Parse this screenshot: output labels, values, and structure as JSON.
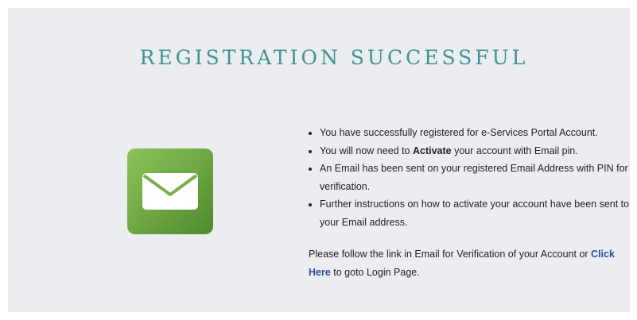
{
  "page": {
    "title": "REGISTRATION SUCCESSFUL"
  },
  "icon": {
    "name": "envelope-icon",
    "tile_color": "#6ea843"
  },
  "bullets": [
    {
      "text": "You have successfully registered for e-Services Portal Account."
    },
    {
      "before": "You will now need to ",
      "bold": "Activate",
      "after": " your account with Email pin."
    },
    {
      "text": "An Email has been sent on your registered Email Address with PIN for verification."
    },
    {
      "text": "Further instructions on how to activate your account have been sent to your Email address."
    }
  ],
  "follow": {
    "text_before": "Please follow the link in Email for Verification of your Account or ",
    "link_label": "Click Here",
    "text_after": " to goto Login Page."
  },
  "colors": {
    "title": "#3f9393",
    "link": "#2e4a9e",
    "panel_bg": "#ebedf0"
  }
}
